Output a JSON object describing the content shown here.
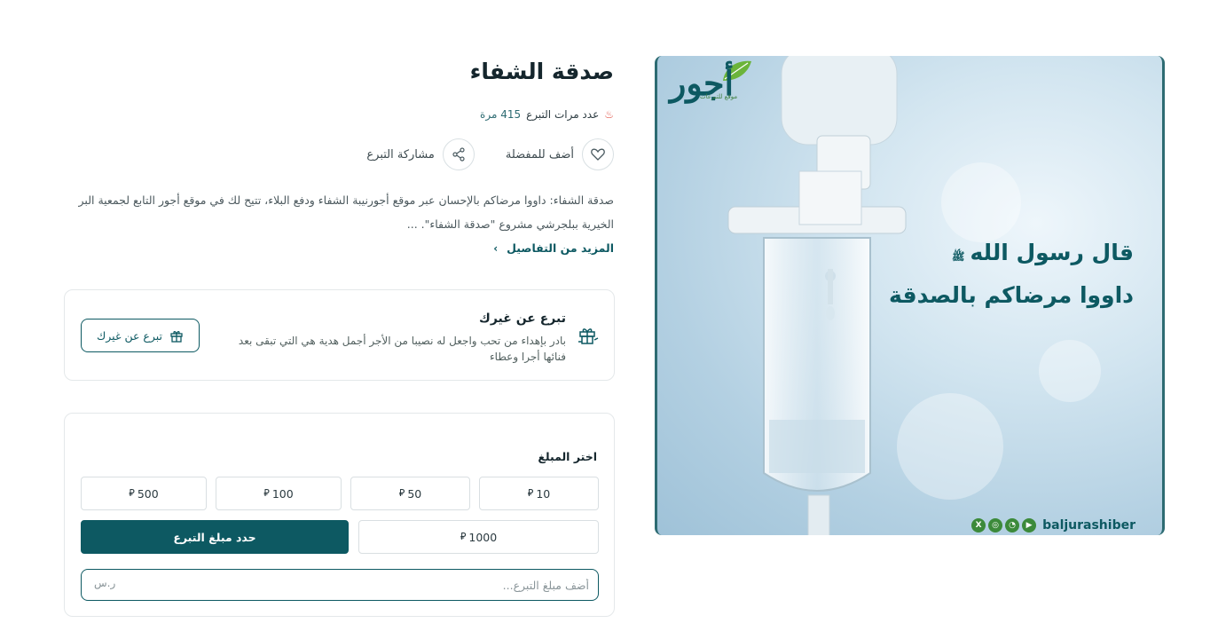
{
  "campaign": {
    "title": "صدقة الشفاء",
    "donation_count_label": "عدد مرات التبرع",
    "donation_count_value": "415 مرة",
    "favorite_label": "أضف للمفضلة",
    "share_label": "مشاركة التبرع",
    "description": "صدقة الشفاء: داووا مرضاكم بالإحسان عبر موقع أجورنيبة الشفاء ودفع البلاء، تتيح لك في موقع أجور التابع لجمعية البر الخيرية ببلجرشي مشروع \"صدقة الشفاء\". ...",
    "more_details_label": "المزيد من التفاصيل"
  },
  "gift": {
    "title": "تبرع عن غيرك",
    "text": "بادر بإهداء من تحب واجعل له نصيبا من الأجر أجمل هدية هي التي تبقى بعد فنائها أجرا وعطاء",
    "button_label": "تبرع عن غيرك"
  },
  "amount": {
    "label": "اختر المبلغ",
    "currency_symbol": "⃁",
    "options": [
      "10",
      "50",
      "100",
      "500",
      "1000"
    ],
    "custom_label": "حدد مبلغ التبرع",
    "input_placeholder": "أضف مبلغ التبرع...",
    "input_suffix": "ر.س"
  },
  "hero": {
    "quote_line_1": "قال رسول الله",
    "pbuh": "ﷺ",
    "quote_line_2": "داووا مرضاكم بالصدقة",
    "logo_text": "أجور",
    "logo_subtitle": "موقع للتبرعات",
    "social_handle": "baljurashiber",
    "social_icons": [
      "x-icon",
      "instagram-icon",
      "snapchat-icon",
      "youtube-icon"
    ]
  },
  "colors": {
    "primary": "#0d5962",
    "accent_red": "#e0564b",
    "logo_green": "#3c8a3a"
  }
}
